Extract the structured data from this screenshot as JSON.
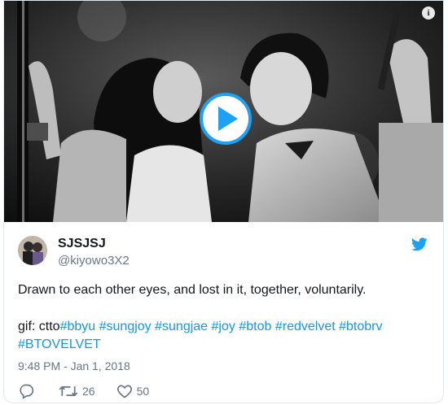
{
  "tweet": {
    "display_name": "SJSJSJ",
    "handle": "@kiyowo3X2",
    "text_line1": "Drawn to each other eyes, and lost in it, together, voluntarily.",
    "gif_prefix": "gif: ctto",
    "hashtags_line1": [
      "#bbyu",
      "#sungjoy",
      "#sungjae",
      "#joy",
      "#btob",
      "#redvelvet",
      "#btobrv"
    ],
    "hashtags_line2": [
      "#BTOVELVET"
    ],
    "timestamp": "9:48 PM - Jan 1, 2018",
    "retweet_count": "26",
    "like_count": "50"
  },
  "media": {
    "info_label": "i",
    "play_label": "Play"
  },
  "colors": {
    "accent": "#1da1f2",
    "link": "#1b95e0",
    "muted": "#657786",
    "text": "#14171a"
  },
  "icons": [
    "info-icon",
    "play-icon",
    "twitter-bird-icon",
    "reply-icon",
    "retweet-icon",
    "heart-icon"
  ]
}
